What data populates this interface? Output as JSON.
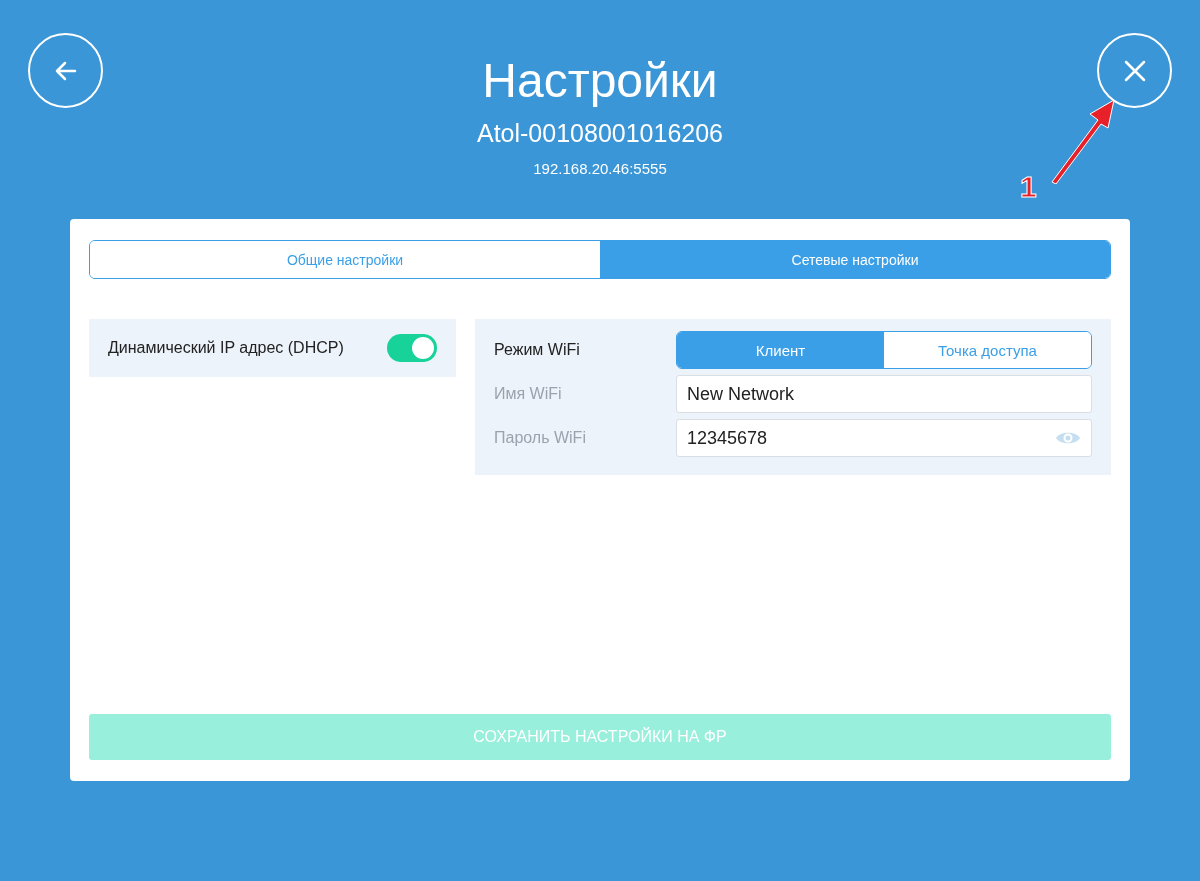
{
  "header": {
    "title": "Настройки",
    "device": "Atol-00108001016206",
    "address": "192.168.20.46:5555"
  },
  "tabs": [
    {
      "label": "Общие настройки",
      "selected": false
    },
    {
      "label": "Сетевые настройки",
      "selected": true
    }
  ],
  "dhcp": {
    "label": "Динамический IP адрес (DHCP)",
    "on": true
  },
  "wifi": {
    "mode_label": "Режим WiFi",
    "modes": [
      {
        "label": "Клиент",
        "selected": true
      },
      {
        "label": "Точка доступа",
        "selected": false
      }
    ],
    "fields": [
      {
        "label": "Имя WiFi",
        "value": "New Network",
        "kind": "text"
      },
      {
        "label": "Пароль WiFi",
        "value": "12345678",
        "kind": "password"
      }
    ]
  },
  "save_button": {
    "label": "СОХРАНИТЬ НАСТРОЙКИ НА ФР",
    "disabled": true
  },
  "annotation": {
    "label": "1"
  }
}
